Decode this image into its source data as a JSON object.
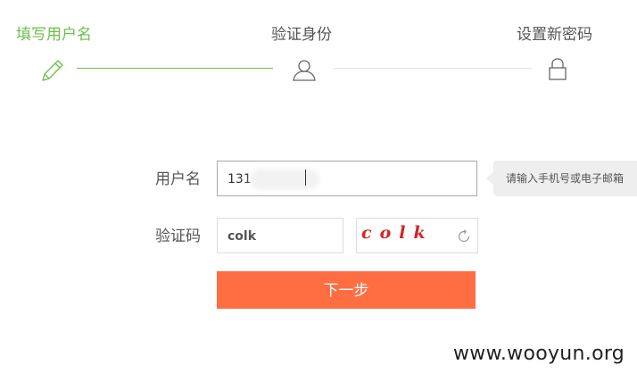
{
  "steps": [
    {
      "label": "填写用户名",
      "icon": "pencil-icon",
      "active": true
    },
    {
      "label": "验证身份",
      "icon": "user-icon",
      "active": false
    },
    {
      "label": "设置新密码",
      "icon": "lock-icon",
      "active": false
    }
  ],
  "colors": {
    "accent_green": "#6cbf4a",
    "button_orange": "#ff6e42",
    "captcha_red": "#d42525"
  },
  "form": {
    "username_label": "用户名",
    "username_value": "131",
    "tooltip": "请输入手机号或电子邮箱",
    "captcha_label": "验证码",
    "captcha_value": "colk",
    "captcha_image_text": "colk",
    "captcha_refresh_icon": "refresh-icon",
    "next_label": "下一步"
  },
  "watermark": "www.wooyun.org"
}
